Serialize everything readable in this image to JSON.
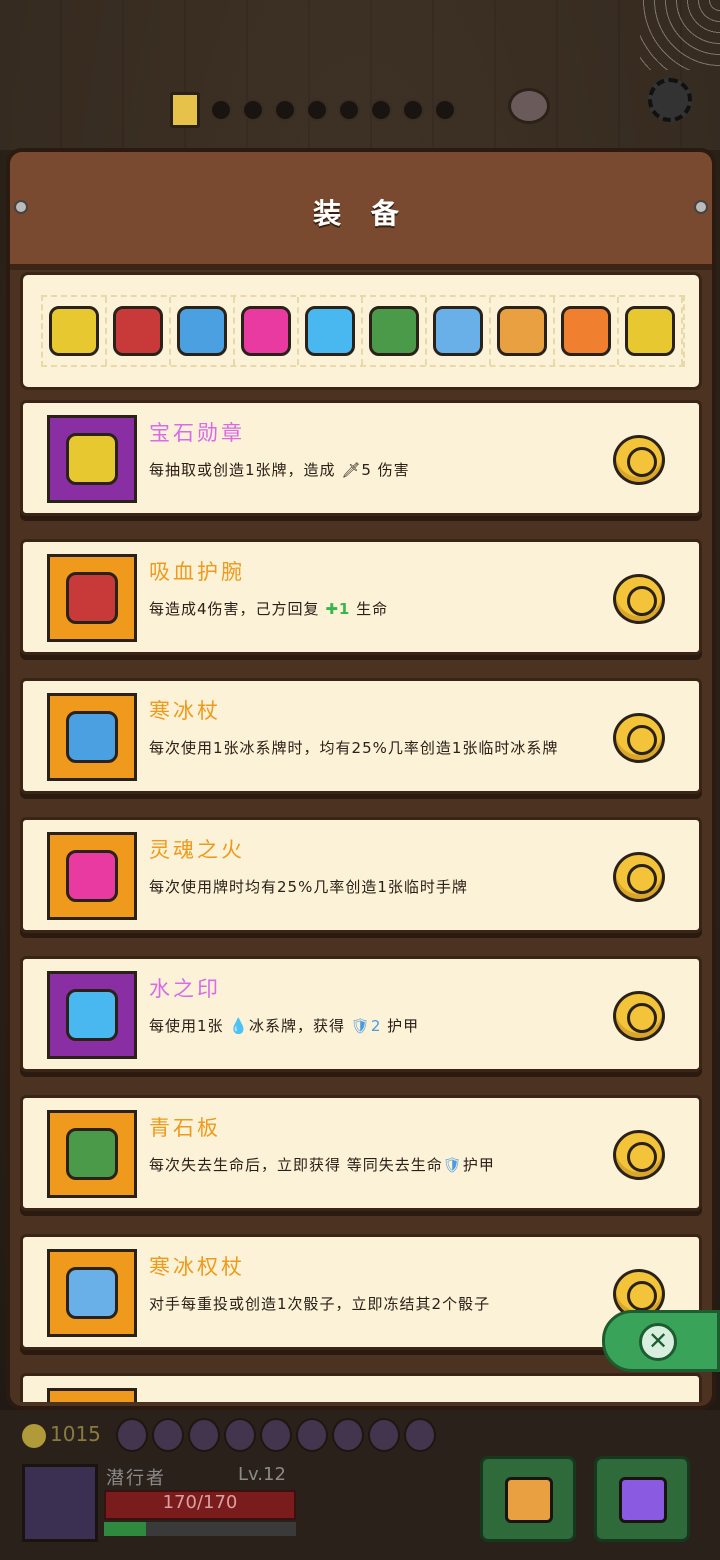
{
  "title": "装 备",
  "top_icons": [
    {
      "name": "gem-medal-icon",
      "color": "#e8c830"
    },
    {
      "name": "spiked-bracelet-icon",
      "color": "#c83a3a"
    },
    {
      "name": "ice-staff-icon",
      "color": "#4aa0e0"
    },
    {
      "name": "soul-fire-icon",
      "color": "#e83aa0"
    },
    {
      "name": "water-drop-icon",
      "color": "#4ab8f0"
    },
    {
      "name": "green-stone-tablet-icon",
      "color": "#4a9a4a"
    },
    {
      "name": "ice-scepter-icon",
      "color": "#6ab0e8"
    },
    {
      "name": "flame-crown-icon",
      "color": "#e8a040"
    },
    {
      "name": "orange-ring-icon",
      "color": "#f08030"
    },
    {
      "name": "blue-gem-amulet-icon",
      "color": "#e8c830"
    }
  ],
  "items": [
    {
      "name": "宝石勋章",
      "rarity": "purple",
      "icon": "gem-medal-icon",
      "icon_color": "#e8c830",
      "desc": "每抽取或创造1张牌，造成 🗡5 伤害"
    },
    {
      "name": "吸血护腕",
      "rarity": "orange",
      "icon": "spiked-bracelet-icon",
      "icon_color": "#c83a3a",
      "desc_parts": [
        "每造成4伤害，己方回复 ",
        "✚1",
        " 生命"
      ]
    },
    {
      "name": "寒冰杖",
      "rarity": "orange",
      "icon": "ice-staff-icon",
      "icon_color": "#4aa0e0",
      "desc": "每次使用1张冰系牌时，均有25%几率创造1张临时冰系牌"
    },
    {
      "name": "灵魂之火",
      "rarity": "orange",
      "icon": "soul-fire-icon",
      "icon_color": "#e83aa0",
      "desc": "每次使用牌时均有25%几率创造1张临时手牌"
    },
    {
      "name": "水之印",
      "rarity": "purple",
      "icon": "water-drop-icon",
      "icon_color": "#4ab8f0",
      "desc_parts": [
        "每使用1张 ",
        "💧",
        "冰系牌，获得 ",
        "🛡2",
        " 护甲"
      ]
    },
    {
      "name": "青石板",
      "rarity": "orange",
      "icon": "green-stone-tablet-icon",
      "icon_color": "#4a9a4a",
      "desc_parts": [
        "每次失去生命后，立即获得 等同失去生命",
        "🛡",
        "护甲"
      ]
    },
    {
      "name": "寒冰权杖",
      "rarity": "orange",
      "icon": "ice-scepter-icon",
      "icon_color": "#6ab0e8",
      "desc": "对手每重投或创造1次骰子，立即冻结其2个骰子"
    },
    {
      "name": "",
      "rarity": "orange",
      "icon": "flame-crown-icon",
      "icon_color": "#e8a040",
      "desc": ""
    }
  ],
  "hud": {
    "gold": "1015",
    "player_name": "潜行者",
    "level": "Lv.12",
    "hp": "170/170",
    "xp_fraction": 0.22
  },
  "colors": {
    "panel": "#7a4a30",
    "parchment": "#fbf2d7",
    "purple": "#8a2ea3",
    "orange": "#ef9a1c",
    "close": "#3aa35a"
  }
}
